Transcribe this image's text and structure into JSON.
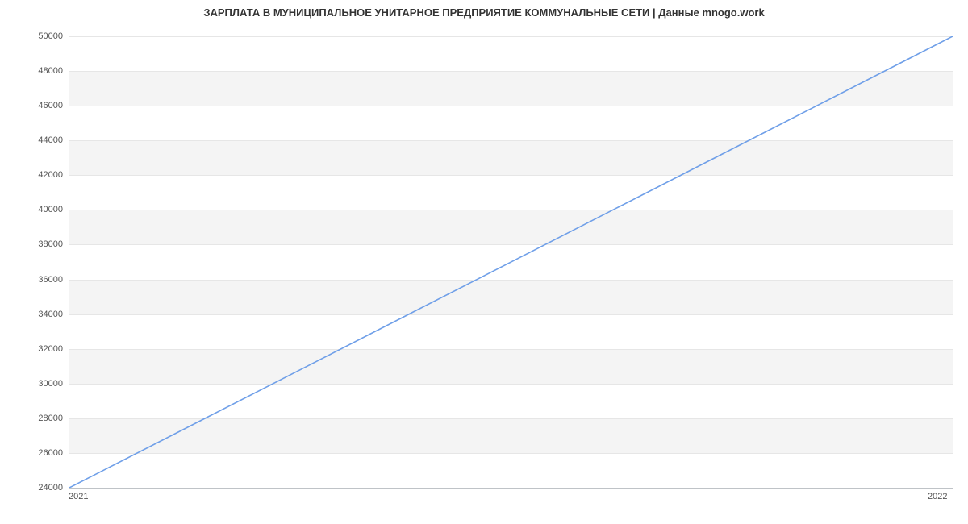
{
  "chart_data": {
    "type": "line",
    "title": "ЗАРПЛАТА В МУНИЦИПАЛЬНОЕ УНИТАРНОЕ ПРЕДПРИЯТИЕ КОММУНАЛЬНЫЕ СЕТИ | Данные mnogo.work",
    "xlabel": "",
    "ylabel": "",
    "x_categories": [
      "2021",
      "2022"
    ],
    "series": [
      {
        "name": "Зарплата",
        "values": [
          24000,
          50000
        ],
        "color": "#6f9fe8"
      }
    ],
    "y_ticks": [
      24000,
      26000,
      28000,
      30000,
      32000,
      34000,
      36000,
      38000,
      40000,
      42000,
      44000,
      46000,
      48000,
      50000
    ],
    "ylim": [
      24000,
      50000
    ]
  }
}
